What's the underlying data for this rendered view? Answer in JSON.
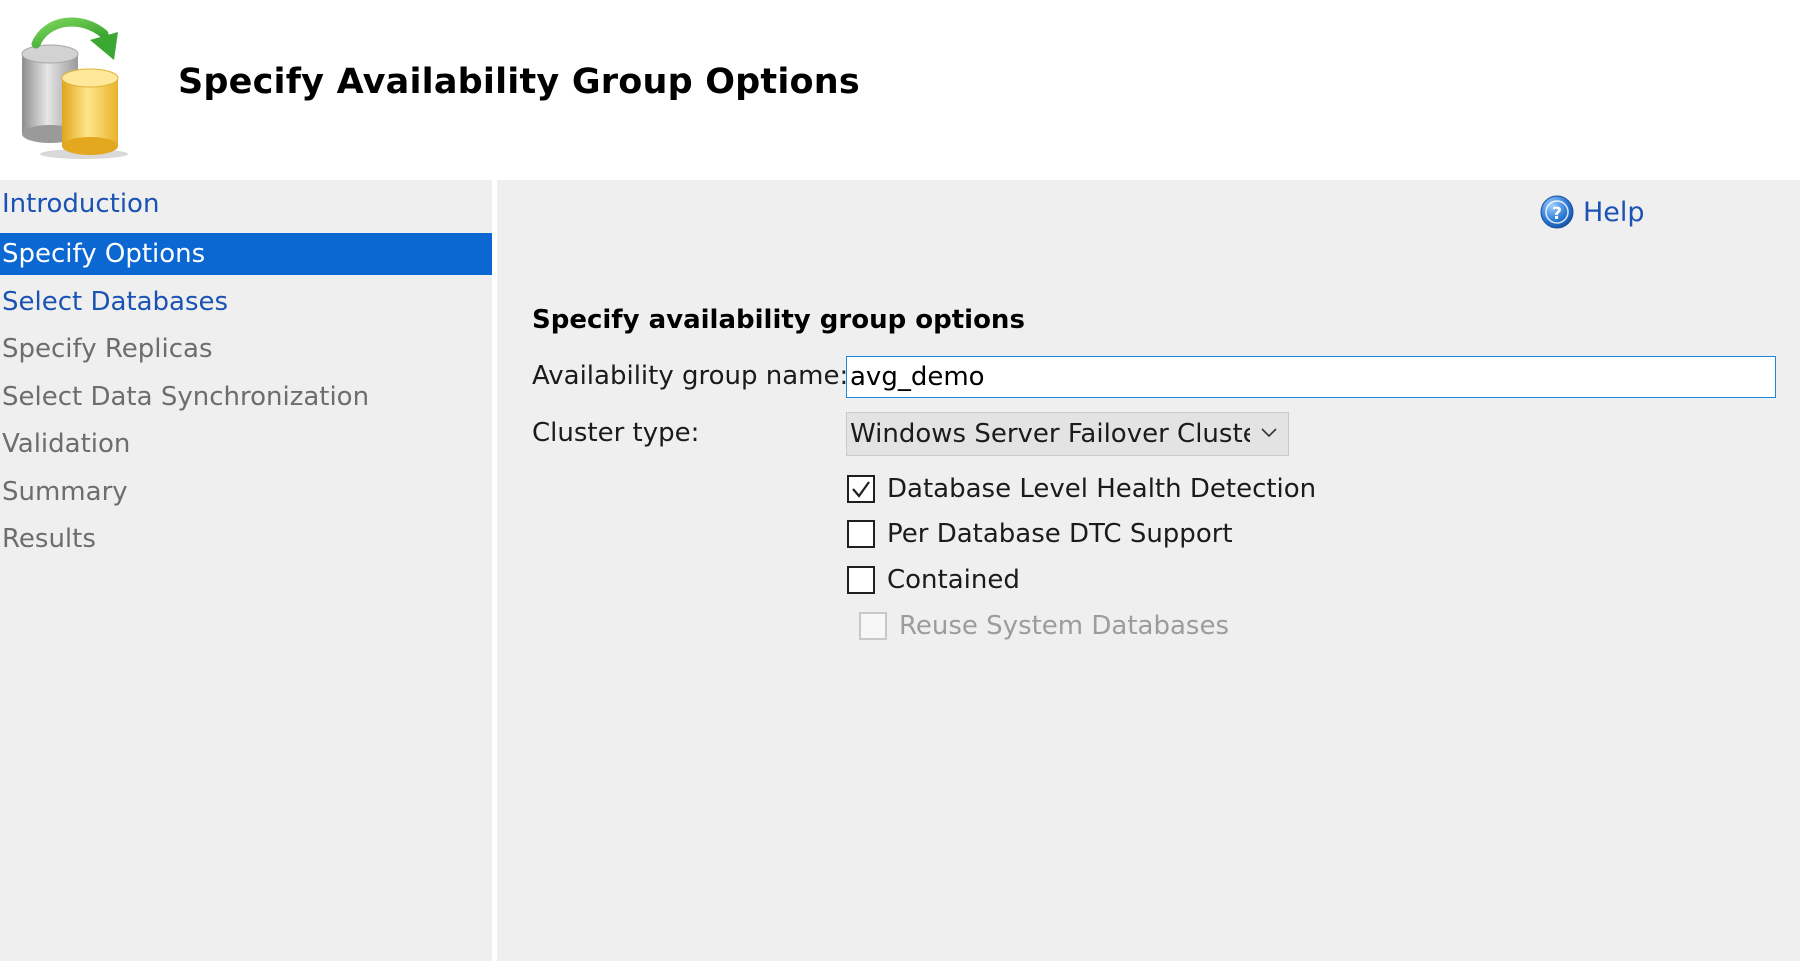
{
  "header": {
    "title": "Specify Availability Group Options",
    "logo_icon": "database-sync-icon"
  },
  "sidebar": {
    "items": [
      {
        "label": "Introduction",
        "state": "link"
      },
      {
        "label": "Specify Options",
        "state": "active"
      },
      {
        "label": "Select Databases",
        "state": "link"
      },
      {
        "label": "Specify Replicas",
        "state": "disabled"
      },
      {
        "label": "Select Data Synchronization",
        "state": "disabled"
      },
      {
        "label": "Validation",
        "state": "disabled"
      },
      {
        "label": "Summary",
        "state": "disabled"
      },
      {
        "label": "Results",
        "state": "disabled"
      }
    ]
  },
  "main": {
    "help_label": "Help",
    "section_heading": "Specify availability group options",
    "name_label": "Availability group name:",
    "name_value": "avg_demo",
    "cluster_label": "Cluster type:",
    "cluster_value": "Windows Server Failover Cluster",
    "checkboxes": [
      {
        "label": "Database Level Health Detection",
        "checked": true,
        "enabled": true
      },
      {
        "label": "Per Database DTC Support",
        "checked": false,
        "enabled": true
      },
      {
        "label": "Contained",
        "checked": false,
        "enabled": true
      },
      {
        "label": "Reuse System Databases",
        "checked": false,
        "enabled": false
      }
    ]
  },
  "colors": {
    "accent": "#0b67d1",
    "link": "#1a53b3",
    "panel_background": "#efefef",
    "disabled_text": "#9c9c9c"
  }
}
